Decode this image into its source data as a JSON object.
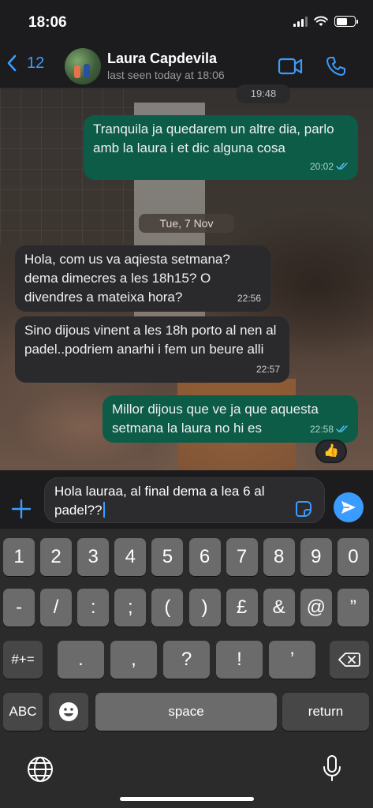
{
  "status_bar": {
    "time": "18:06"
  },
  "header": {
    "back_count": "12",
    "contact_name": "Laura Capdevila",
    "last_seen": "last seen today at 18:06"
  },
  "messages": [
    {
      "direction": "in",
      "text": "",
      "time": "19:48"
    },
    {
      "direction": "out",
      "text": "Tranquila ja quedarem un altre dia, parlo amb la laura i et dic alguna cosa",
      "time": "20:02",
      "status": "read"
    },
    {
      "direction": "in",
      "text": "Hola, com us va aqiesta setmana? dema dimecres a les 18h15? O divendres a mateixa hora?",
      "time": "22:56"
    },
    {
      "direction": "in",
      "text": "Sino dijous vinent a les 18h porto al nen al padel..podriem anarhi i fem un beure alli",
      "time": "22:57"
    },
    {
      "direction": "out",
      "text": "Millor dijous que ve ja que aquesta setmana la laura no hi es",
      "time": "22:58",
      "status": "read",
      "reaction": "👍"
    }
  ],
  "date_separator": "Tue, 7 Nov",
  "composer": {
    "draft": "Hola lauraa, al final dema a lea 6 al padel??"
  },
  "keyboard": {
    "row1": [
      "1",
      "2",
      "3",
      "4",
      "5",
      "6",
      "7",
      "8",
      "9",
      "0"
    ],
    "row2": [
      "-",
      "/",
      ":",
      ";",
      "(",
      ")",
      "£",
      "&",
      "@",
      "”"
    ],
    "row3": [
      "#+=",
      ".",
      ",",
      "?",
      "!",
      "’"
    ],
    "abc": "ABC",
    "space": "space",
    "return": "return"
  },
  "colors": {
    "accent": "#3b9cff",
    "outgoing": "#0d5c48",
    "incoming": "#2a2a2c"
  },
  "icons": [
    "back-chevron-icon",
    "video-call-icon",
    "phone-icon",
    "plus-icon",
    "sticker-icon",
    "send-icon",
    "backspace-icon",
    "emoji-icon",
    "globe-icon",
    "microphone-icon",
    "double-check-icon"
  ]
}
